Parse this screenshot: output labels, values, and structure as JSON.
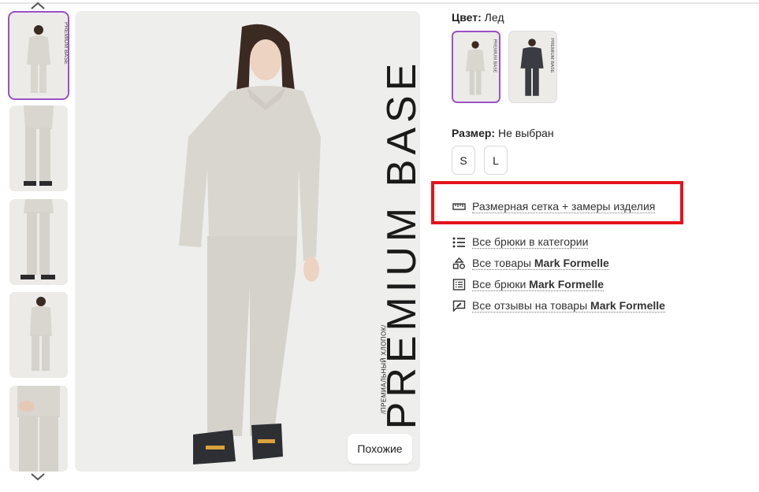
{
  "product": {
    "brand_vertical": "PREMIUM BASE",
    "brand_sub": "/ПРЕМИАЛЬНЫЙ ХЛОПОК/",
    "similar_button": "Похожие"
  },
  "color": {
    "label": "Цвет:",
    "value": "Лед",
    "swatches": [
      {
        "name": "Лед",
        "hex": "#d9d6cf",
        "selected": true
      },
      {
        "name": "Темно-серый",
        "hex": "#3b3b42",
        "selected": false
      }
    ]
  },
  "size": {
    "label": "Размер:",
    "value": "Не выбран",
    "options": [
      "S",
      "L"
    ]
  },
  "links": {
    "size_chart": "Размерная сетка + замеры изделия",
    "category": "Все брюки в категории",
    "all_goods_prefix": "Все товары",
    "all_pants_prefix": "Все брюки",
    "reviews_prefix": "Все отзывы на товары",
    "brand": "Mark Formelle"
  },
  "colors": {
    "selected_outline": "#9a52c7",
    "highlight": "#e3141c",
    "garment": "#d9d6cf"
  }
}
